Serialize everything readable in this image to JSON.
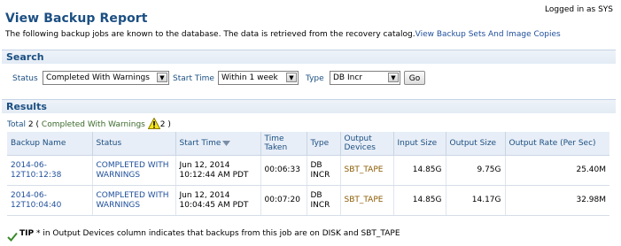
{
  "header": {
    "logged_in": "Logged in as SYS",
    "title": "View Backup Report",
    "description": "The following backup jobs are known to the database. The data is retrieved from the recovery catalog.",
    "link": "View Backup Sets And Image Copies"
  },
  "search": {
    "section_title": "Search",
    "status_label": "Status",
    "status_value": "Completed With Warnings",
    "start_time_label": "Start Time",
    "start_time_value": "Within 1 week",
    "type_label": "Type",
    "type_value": "DB Incr",
    "go_label": "Go"
  },
  "results": {
    "section_title": "Results",
    "total_label": "Total",
    "total_count": "2",
    "open_paren": "(",
    "warnings_label": "Completed With Warnings",
    "warnings_count": "2",
    "close_paren": ")",
    "columns": {
      "backup_name": "Backup Name",
      "status": "Status",
      "start_time": "Start Time",
      "time_taken_1": "Time",
      "time_taken_2": "Taken",
      "type": "Type",
      "output_devices_1": "Output",
      "output_devices_2": "Devices",
      "input_size": "Input Size",
      "output_size": "Output Size",
      "output_rate": "Output Rate (Per Sec)"
    },
    "rows": [
      {
        "backup_name": "2014-06-12T10:12:38",
        "status_1": "COMPLETED WITH",
        "status_2": "WARNINGS",
        "start_1": "Jun 12, 2014",
        "start_2": "10:12:44 AM PDT",
        "time_taken": "00:06:33",
        "type_1": "DB",
        "type_2": "INCR",
        "output_devices": "SBT_TAPE",
        "input_size": "14.85G",
        "output_size": "9.75G",
        "output_rate": "25.40M"
      },
      {
        "backup_name": "2014-06-12T10:04:40",
        "status_1": "COMPLETED WITH",
        "status_2": "WARNINGS",
        "start_1": "Jun 12, 2014",
        "start_2": "10:04:45 AM PDT",
        "time_taken": "00:07:20",
        "type_1": "DB",
        "type_2": "INCR",
        "output_devices": "SBT_TAPE",
        "input_size": "14.85G",
        "output_size": "14.17G",
        "output_rate": "32.98M"
      }
    ]
  },
  "tip": {
    "label": "TIP",
    "text": " * in Output Devices column indicates that backups from this job are on DISK and SBT_TAPE"
  },
  "icons": {
    "warning": "warning-icon",
    "sort": "sort-descending-icon",
    "tip": "checkmark-icon",
    "dropdown": "chevron-down-icon"
  },
  "colors": {
    "title": "#1b4f82",
    "link": "#1f4f9b",
    "device_link": "#8a5a00",
    "warning_text": "#3b6a2b",
    "section_bg": "#e8eef7"
  }
}
